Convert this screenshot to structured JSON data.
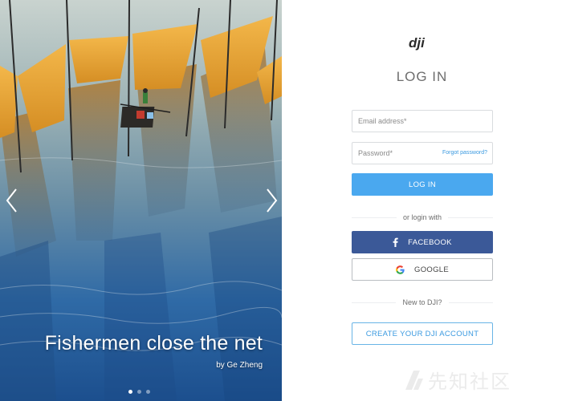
{
  "slider": {
    "caption_title": "Fishermen close the net",
    "caption_credit": "by Ge Zheng",
    "dots": [
      true,
      false,
      false
    ],
    "prev_icon": "chevron-left-icon",
    "next_icon": "chevron-right-icon"
  },
  "login": {
    "logo_text": "dji",
    "title": "LOG IN",
    "email_placeholder": "Email address*",
    "password_placeholder": "Password*",
    "forgot_label": "Forgot password?",
    "login_button": "LOG IN",
    "or_label": "or login with",
    "facebook_label": "FACEBOOK",
    "google_label": "GOOGLE",
    "new_label": "New to DJI?",
    "create_label": "CREATE YOUR DJI ACCOUNT"
  },
  "watermark": {
    "text": "先知社区"
  },
  "colors": {
    "primary": "#4aa8ef",
    "facebook": "#3b5998",
    "link": "#3b9ae0",
    "title_gray": "#6d6d6d"
  }
}
